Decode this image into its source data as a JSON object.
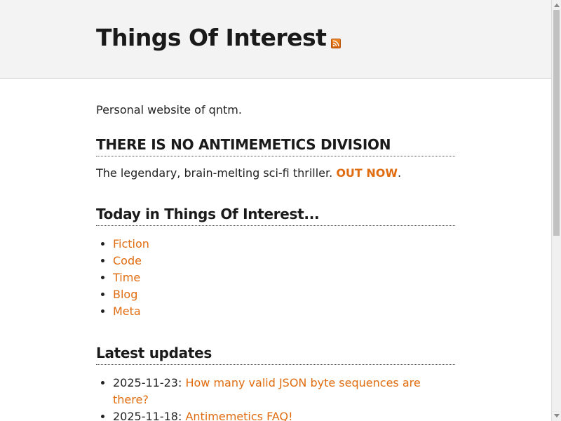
{
  "header": {
    "site_title": "Things Of Interest",
    "rss_icon": "rss-feed-icon"
  },
  "main": {
    "intro": "Personal website of qntm.",
    "antimemetics": {
      "heading": "THERE IS NO ANTIMEMETICS DIVISION",
      "text": "The legendary, brain-melting sci-fi thriller.",
      "link": "OUT NOW",
      "suffix": "."
    },
    "today": {
      "heading": "Today in Things Of Interest...",
      "items": [
        "Fiction",
        "Code",
        "Time",
        "Blog",
        "Meta"
      ]
    },
    "updates": {
      "heading": "Latest updates",
      "items": [
        {
          "date": "2025-11-23: ",
          "title": "How many valid JSON byte sequences are there?"
        },
        {
          "date": "2025-11-18: ",
          "title": "Antimemetics FAQ!"
        }
      ]
    }
  },
  "colors": {
    "link": "#e06c10",
    "header_bg": "#f3f3f3"
  }
}
